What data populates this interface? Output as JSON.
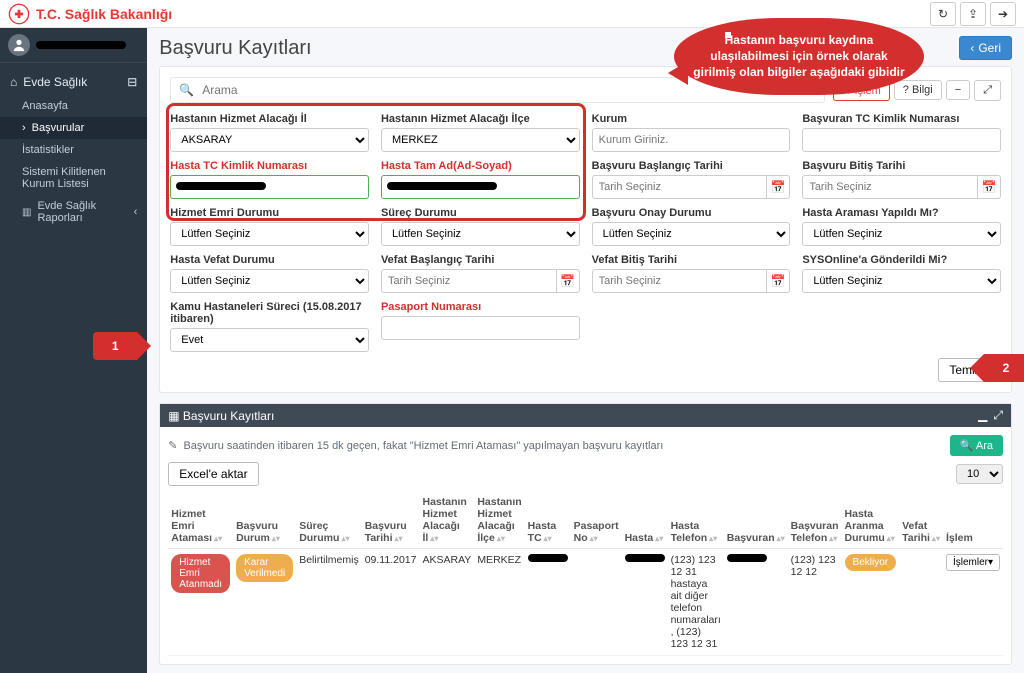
{
  "brand": "T.C. Sağlık Bakanlığı",
  "top_icons": {
    "refresh": "↻",
    "share": "⇪",
    "logout": "➔"
  },
  "user": {
    "name": "██████████"
  },
  "sidebar": {
    "group": "Evde Sağlık",
    "items": [
      "Anasayfa",
      "Başvurular",
      "İstatistikler",
      "Sistemi Kilitlenen Kurum Listesi",
      "Evde Sağlık Raporları"
    ],
    "active_index": 1
  },
  "page": {
    "title": "Başvuru Kayıtları",
    "back_label": "Geri"
  },
  "search": {
    "placeholder": "Arama"
  },
  "tabs": {
    "islem": "İşlem",
    "bilgi": "? Bilgi",
    "min": "−",
    "max": "⤢"
  },
  "filters": {
    "il_label": "Hastanın Hizmet Alacağı İl",
    "il_value": "AKSARAY",
    "ilce_label": "Hastanın Hizmet Alacağı İlçe",
    "ilce_value": "MERKEZ",
    "kurum_label": "Kurum",
    "kurum_ph": "Kurum Giriniz.",
    "basvuran_tc_label": "Başvuran TC Kimlik Numarası",
    "hasta_tc_label": "Hasta TC Kimlik Numarası",
    "hasta_ad_label": "Hasta Tam Ad(Ad-Soyad)",
    "bas_tarih_label": "Başvuru Başlangıç Tarihi",
    "bitis_label": "Başvuru Bitiş Tarihi",
    "tarih_ph": "Tarih Seçiniz",
    "hizmet_emri_label": "Hizmet Emri Durumu",
    "surec_label": "Süreç Durumu",
    "onay_label": "Başvuru Onay Durumu",
    "arama_label": "Hasta Araması Yapıldı Mı?",
    "vefat_label": "Hasta Vefat Durumu",
    "vefat_bas_label": "Vefat Başlangıç Tarihi",
    "vefat_bit_label": "Vefat Bitiş Tarihi",
    "sys_label": "SYSOnline'a Gönderildi Mi?",
    "khs_label": "Kamu Hastaneleri Süreci (15.08.2017 itibaren)",
    "pasaport_label": "Pasaport Numarası",
    "sel_ph": "Lütfen Seçiniz",
    "evet": "Evet",
    "temizle": "Temizle"
  },
  "callout": "Hastanın başvuru kaydına ulaşılabilmesi için örnek olarak girilmiş olan bilgiler aşağıdaki gibidir",
  "arrow1": "1",
  "arrow2": "2",
  "panel": {
    "title": "Başvuru Kayıtları",
    "note": "Başvuru saatinden itibaren 15 dk geçen, fakat \"Hizmet Emri Ataması\" yapılmayan başvuru kayıtları",
    "excel": "Excel'e aktar",
    "ara": "Ara",
    "page_size": "10"
  },
  "table": {
    "headers": [
      "Hizmet Emri Ataması",
      "Başvuru Durum",
      "Süreç Durumu",
      "Başvuru Tarihi",
      "Hastanın Hizmet Alacağı İl",
      "Hastanın Hizmet Alacağı İlçe",
      "Hasta TC",
      "Pasaport No",
      "Hasta",
      "Hasta Telefon",
      "Başvuran",
      "Başvuran Telefon",
      "Hasta Aranma Durumu",
      "Vefat Tarihi",
      "İşlem"
    ],
    "row": {
      "hizmet_emri": "Hizmet Emri Atanmadı",
      "basvuru_durum": "Karar Verilmedi",
      "surec": "Belirtilmemiş",
      "tarih": "09.11.2017",
      "il": "AKSARAY",
      "ilce": "MERKEZ",
      "telefon": "(123) 123 12 31 hastaya ait diğer telefon numaraları , (123) 123 12 31",
      "basvuran_tel": "(123) 123 12 12",
      "aranma": "Bekliyor",
      "islem_btn": "İşlemler"
    }
  }
}
